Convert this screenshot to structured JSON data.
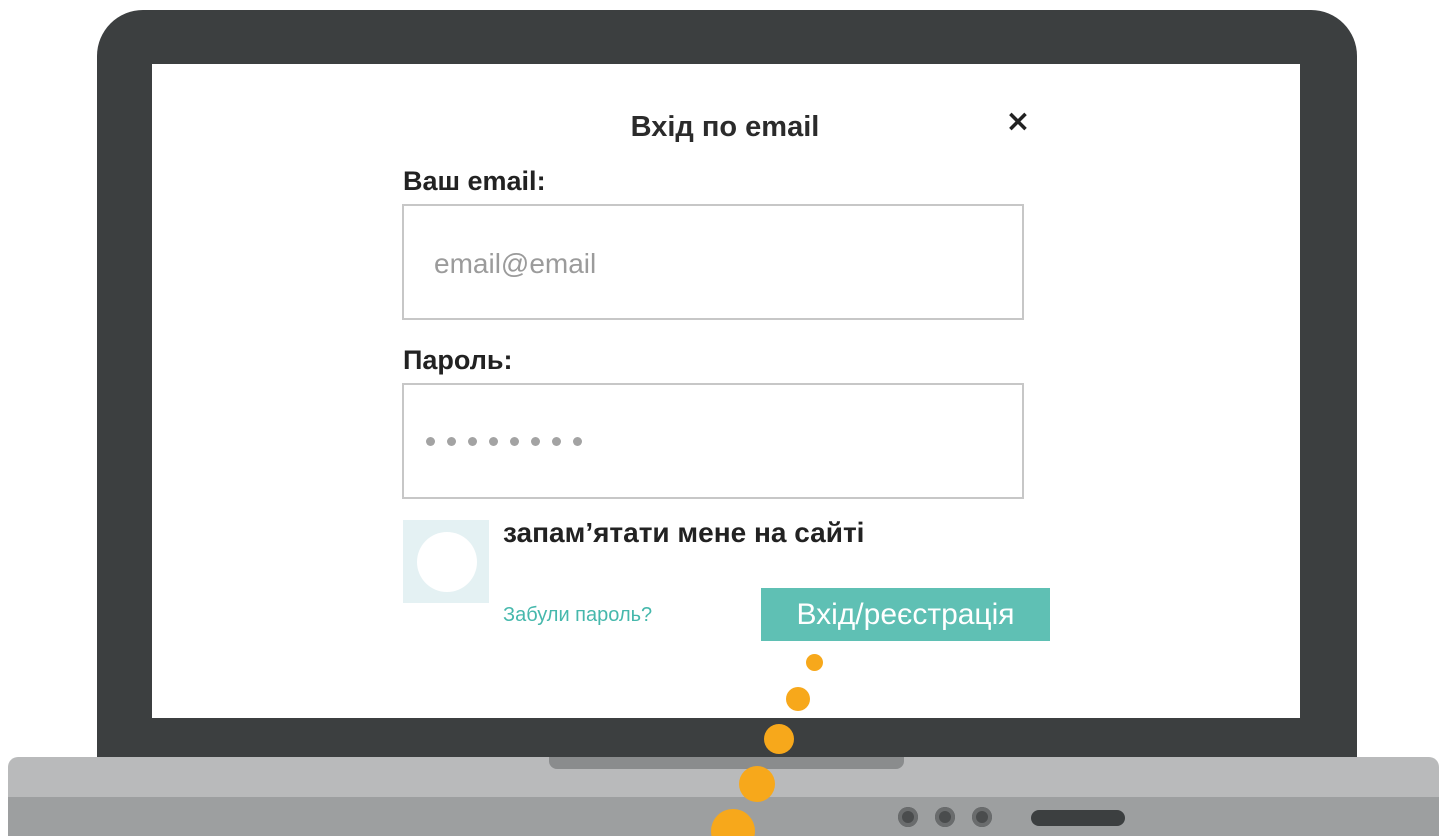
{
  "dialog": {
    "title": "Вхід по email",
    "close_icon": "close-icon",
    "email": {
      "label": "Ваш email:",
      "placeholder": "email@email",
      "value": ""
    },
    "password": {
      "label": "Пароль:",
      "masked_dot_count": 8
    },
    "remember": {
      "label": "запам’ятати мене на сайті",
      "checked": false
    },
    "forgot_link": "Забули пароль?",
    "submit_label": "Вхід/реєстрація"
  },
  "colors": {
    "accent": "#5fc0b4",
    "link": "#46b8ac",
    "laptop_frame": "#3c3f40",
    "trail": "#f7a81b"
  }
}
